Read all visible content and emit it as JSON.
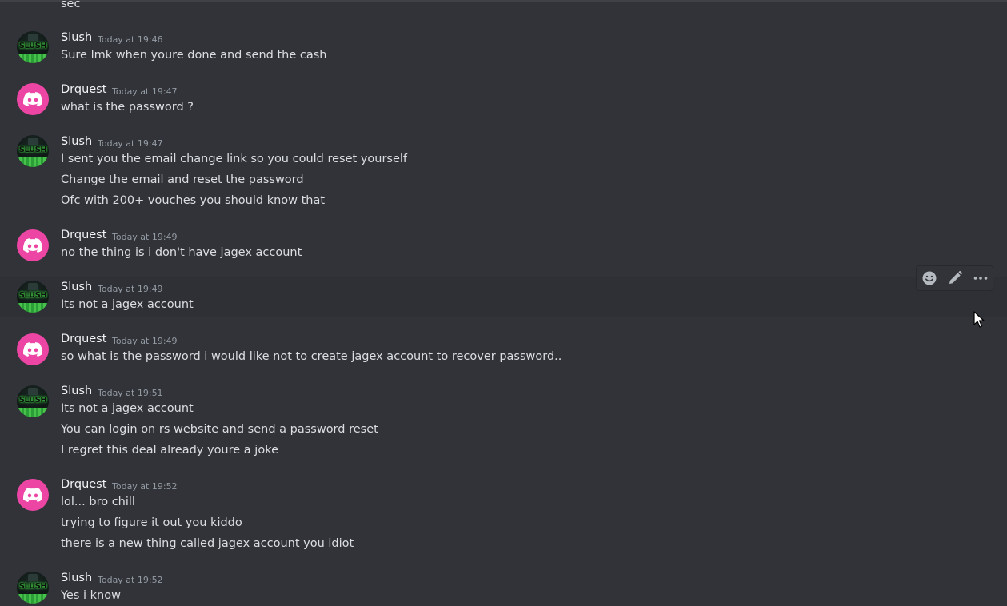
{
  "messages": [
    {
      "author": "",
      "timestamp": "",
      "lines": [
        "sec"
      ]
    },
    {
      "author": "Slush",
      "avatar": "slush-avatar",
      "timestamp": "Today at 19:46",
      "lines": [
        "Sure lmk when youre done and send the cash"
      ]
    },
    {
      "author": "Drquest",
      "avatar": "discord-default-avatar",
      "timestamp": "Today at 19:47",
      "lines": [
        "what is the password ?"
      ]
    },
    {
      "author": "Slush",
      "avatar": "slush-avatar",
      "timestamp": "Today at 19:47",
      "lines": [
        "I sent you the email change link so you could reset yourself",
        "Change the email and reset the password",
        "Ofc with 200+ vouches you should know that"
      ]
    },
    {
      "author": "Drquest",
      "avatar": "discord-default-avatar",
      "timestamp": "Today at 19:49",
      "lines": [
        "no the thing is i don't have jagex account"
      ]
    },
    {
      "author": "Slush",
      "avatar": "slush-avatar",
      "timestamp": "Today at 19:49",
      "lines": [
        "Its not a jagex account"
      ]
    },
    {
      "author": "Drquest",
      "avatar": "discord-default-avatar",
      "timestamp": "Today at 19:49",
      "lines": [
        "so what is the password i would like not to create jagex account to recover password.."
      ]
    },
    {
      "author": "Slush",
      "avatar": "slush-avatar",
      "timestamp": "Today at 19:51",
      "lines": [
        "Its not a jagex account",
        "You can login on rs website and send a password reset",
        "I regret this deal already youre a joke"
      ]
    },
    {
      "author": "Drquest",
      "avatar": "discord-default-avatar",
      "timestamp": "Today at 19:52",
      "lines": [
        "lol... bro chill",
        "trying to figure it out you kiddo",
        "there is a new thing called jagex account you idiot"
      ]
    },
    {
      "author": "Slush",
      "avatar": "slush-avatar",
      "timestamp": "Today at 19:52",
      "lines": [
        "Yes i know"
      ]
    }
  ],
  "avatar_texts": {
    "slush": "SLUSH"
  },
  "toolbar": {
    "icons": [
      "add-reaction-icon",
      "edit-icon",
      "more-options-icon"
    ]
  },
  "colors": {
    "background": "#313338",
    "hover_background": "#2e3035",
    "username": "#f2f3f5",
    "message_text": "#dbdee1",
    "timestamp": "#949ba4",
    "discord_avatar": "#ec45a4"
  }
}
